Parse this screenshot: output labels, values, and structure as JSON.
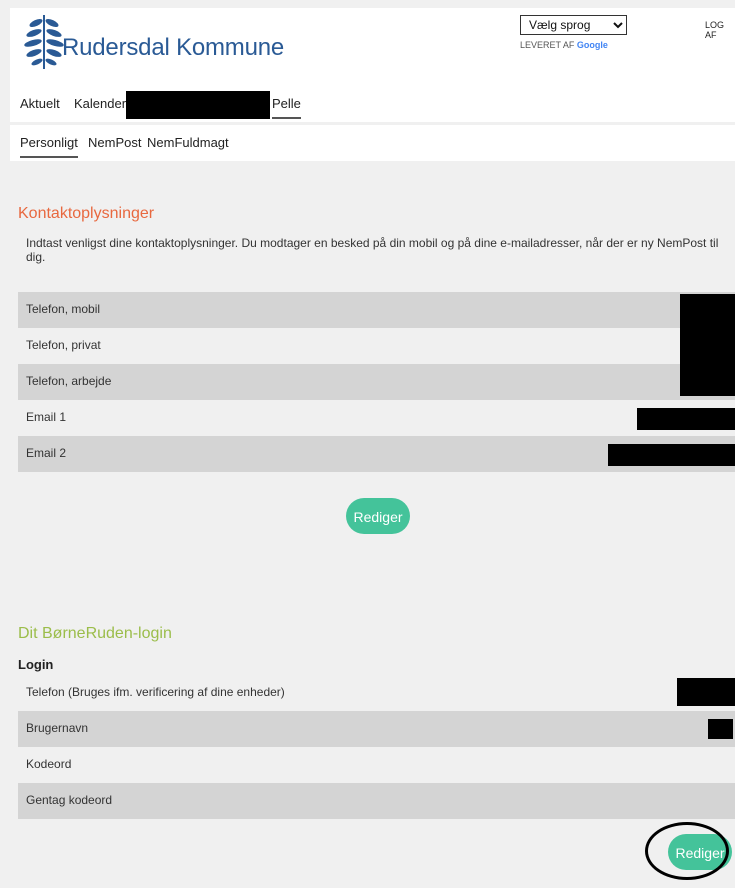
{
  "header": {
    "brand": "Rudersdal Kommune",
    "language_select": "Vælg sprog",
    "powered_by": "LEVERET AF",
    "powered_brand": "Google",
    "logout": "LOG AF"
  },
  "nav": {
    "items": [
      "Aktuelt",
      "Kalender"
    ],
    "user": "Pelle"
  },
  "subnav": {
    "items": [
      "Personligt",
      "NemPost",
      "NemFuldmagt"
    ]
  },
  "contact": {
    "title": "Kontaktoplysninger",
    "intro": "Indtast venligst dine kontaktoplysninger. Du modtager en besked på din mobil og på dine e-mailadresser, når der er ny NemPost til dig.",
    "rows": [
      "Telefon, mobil",
      "Telefon, privat",
      "Telefon, arbejde",
      "Email 1",
      "Email 2"
    ],
    "edit_label": "Rediger"
  },
  "login": {
    "title": "Dit BørneRuden-login",
    "subtitle": "Login",
    "rows": [
      "Telefon (Bruges ifm. verificering af dine enheder)",
      "Brugernavn",
      "Kodeord",
      "Gentag kodeord"
    ],
    "edit_label": "Rediger"
  },
  "colors": {
    "accent_orange": "#e8683f",
    "accent_green": "#9bbd4a",
    "button": "#44c39a",
    "brand_blue": "#2a5a95"
  }
}
